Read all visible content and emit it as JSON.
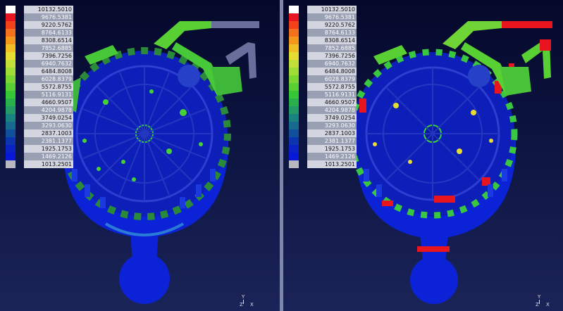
{
  "legend": {
    "values": [
      "10132.5010",
      "9676.5381",
      "9220.5762",
      "8764.6133",
      "8308.6514",
      "7852.6885",
      "7396.7256",
      "6940.7632",
      "6484.8008",
      "6028.8379",
      "5572.8755",
      "5116.9131",
      "4660.9507",
      "4204.9878",
      "3749.0254",
      "3293.0630",
      "2837.1003",
      "2381.1377",
      "1925.1753",
      "1469.2126",
      "1013.2501"
    ],
    "colors": [
      "#ffffff",
      "#e8151e",
      "#f2421c",
      "#f4721e",
      "#f3981c",
      "#f2be25",
      "#e6dd33",
      "#c3e03a",
      "#9fdc35",
      "#7bd633",
      "#58d033",
      "#36c736",
      "#2ab04a",
      "#249a66",
      "#1c8280",
      "#166b8f",
      "#10509a",
      "#0c34ad",
      "#0a22c4",
      "#0818d8",
      "#b8b8c0"
    ]
  },
  "axes": {
    "y": "Y",
    "z": "Z",
    "x": "X"
  }
}
